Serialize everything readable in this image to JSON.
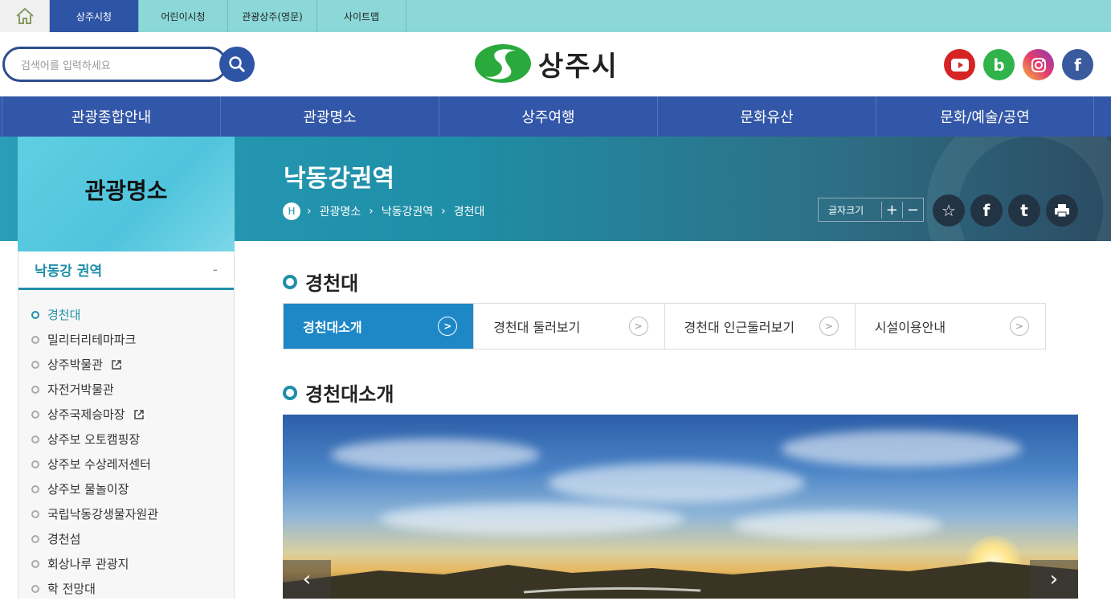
{
  "topbar": {
    "tabs": [
      "상주시청",
      "어린이시청",
      "관광상주(영문)",
      "사이트맵"
    ],
    "active_tab": "상주시청"
  },
  "header": {
    "search_placeholder": "검색어를 입력하세요",
    "logo_text": "상주시",
    "sns": [
      "youtube-icon",
      "blog-icon",
      "instagram-icon",
      "facebook-icon"
    ]
  },
  "mainnav": {
    "items": [
      "관광종합안내",
      "관광명소",
      "상주여행",
      "문화유산",
      "문화/예술/공연"
    ]
  },
  "banner": {
    "section_title": "관광명소",
    "page_title": "낙동강권역",
    "breadcrumb_home": "H",
    "breadcrumb": [
      "관광명소",
      "낙동강권역",
      "경천대"
    ],
    "fontsize_label": "글자크기"
  },
  "lnb": {
    "head": "낙동강 권역",
    "collapse": "-",
    "items": [
      "경천대",
      "밀리터리테마파크",
      "상주박물관",
      "자전거박물관",
      "상주국제승마장",
      "상주보 오토캠핑장",
      "상주보 수상레저센터",
      "상주보 물놀이장",
      "국립낙동강생물자원관",
      "경천섬",
      "회상나루 관광지",
      "학 전망대"
    ],
    "active": "경천대"
  },
  "content": {
    "title": "경천대",
    "tabs": [
      "경천대소개",
      "경천대 둘러보기",
      "경천대 인근둘러보기",
      "시설이용안내"
    ],
    "active_tab": "경천대소개",
    "tab_arrow": ">",
    "section_title": "경천대소개"
  },
  "colors": {
    "accent": "#1f8fa8",
    "nav": "#3357a8",
    "active_tab": "#1e88c7"
  }
}
